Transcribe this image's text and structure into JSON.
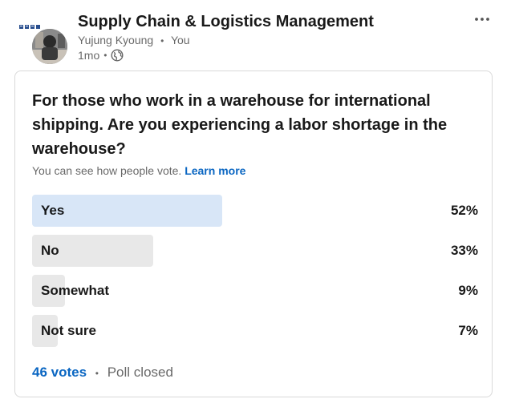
{
  "post": {
    "group_name": "Supply Chain & Logistics Management",
    "author": "Yujung Kyoung",
    "author_separator": "•",
    "relation": "You",
    "time": "1mo",
    "time_separator": "•",
    "visibility_icon": "globe-icon",
    "more_icon": "more-options-icon"
  },
  "poll": {
    "question": "For those who work in a warehouse for international shipping. Are you experiencing a labor shortage in the warehouse?",
    "visibility_note": "You can see how people vote.",
    "learn_more": "Learn more",
    "options": [
      {
        "label": "Yes",
        "percent_label": "52%",
        "percent": 52,
        "selected": true
      },
      {
        "label": "No",
        "percent_label": "33%",
        "percent": 33,
        "selected": false
      },
      {
        "label": "Somewhat",
        "percent_label": "9%",
        "percent": 9,
        "selected": false
      },
      {
        "label": "Not sure",
        "percent_label": "7%",
        "percent": 7,
        "selected": false
      }
    ],
    "votes": "46 votes",
    "footer_separator": "•",
    "status": "Poll closed"
  },
  "colors": {
    "link": "#0a66c2",
    "selected_bar": "#d8e6f7",
    "bar": "#e8e8e8",
    "border": "#d9d9d9"
  }
}
